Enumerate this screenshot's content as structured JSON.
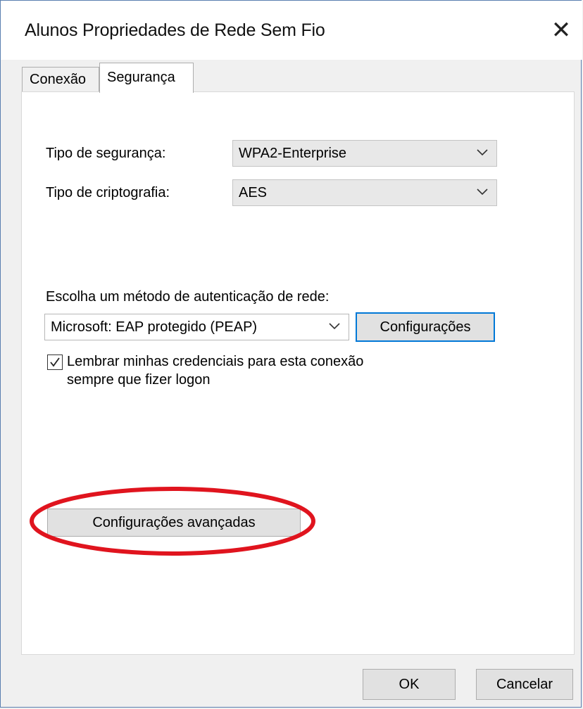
{
  "window": {
    "title": "Alunos Propriedades de Rede Sem Fio",
    "close_icon": "close-icon",
    "close_glyph": "✕"
  },
  "tabs": [
    {
      "label": "Conexão",
      "active": false
    },
    {
      "label": "Segurança",
      "active": true
    }
  ],
  "security": {
    "type_label": "Tipo de segurança:",
    "type_value": "WPA2-Enterprise",
    "encryption_label": "Tipo de criptografia:",
    "encryption_value": "AES",
    "auth_method_label": "Escolha um método de autenticação de rede:",
    "auth_method_value": "Microsoft: EAP protegido (PEAP)",
    "settings_button": "Configurações",
    "remember_checked": true,
    "remember_line1": "Lembrar minhas credenciais para esta conexão",
    "remember_line2": "sempre que fizer logon",
    "advanced_button": "Configurações avançadas"
  },
  "footer": {
    "ok_label": "OK",
    "cancel_label": "Cancelar"
  },
  "colors": {
    "focus_border": "#0078d7",
    "highlight_ring": "#e0141e"
  }
}
